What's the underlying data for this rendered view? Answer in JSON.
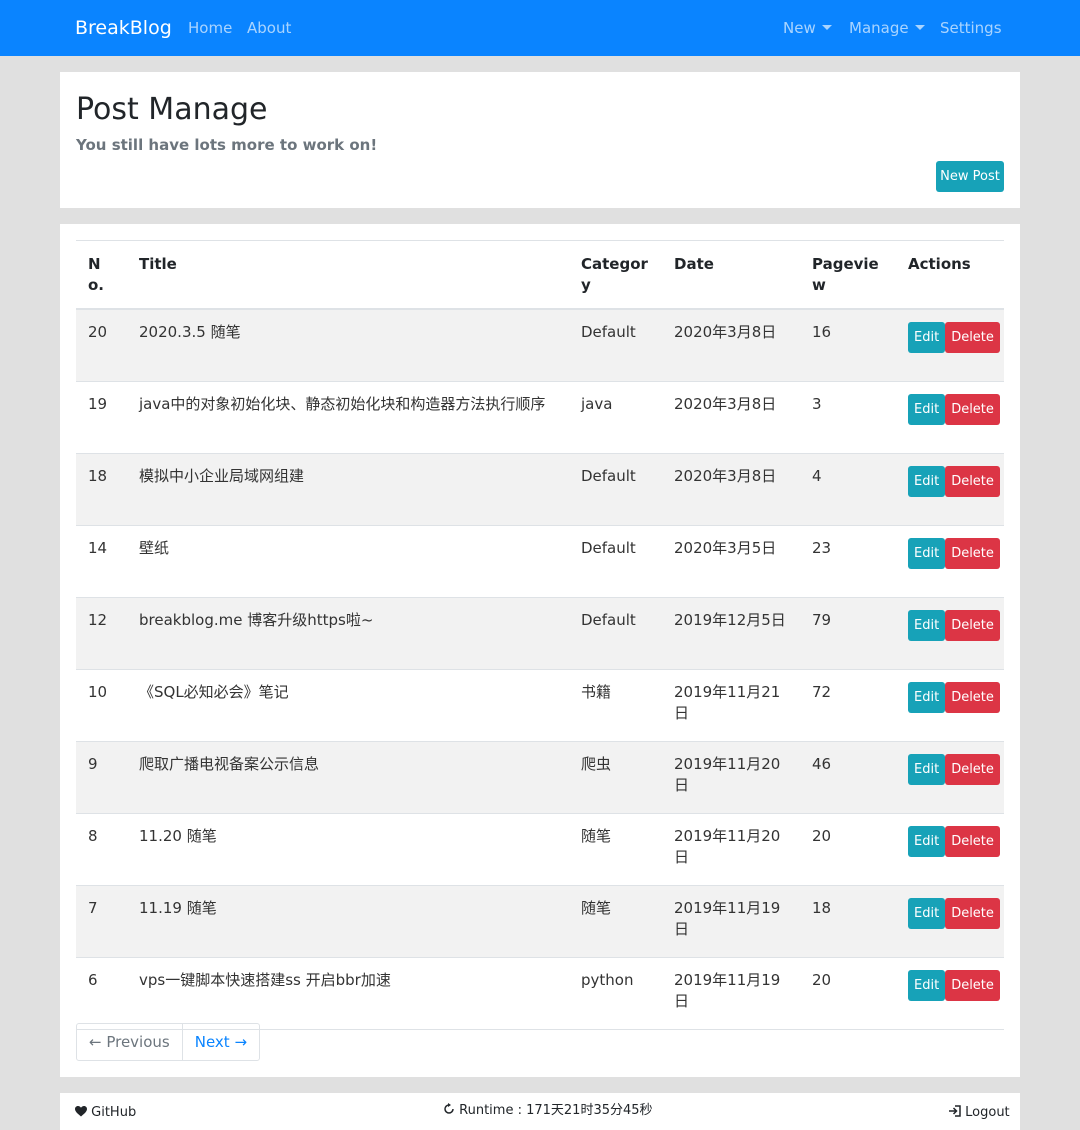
{
  "nav": {
    "brand": "BreakBlog",
    "links": [
      "Home",
      "About"
    ],
    "right": [
      {
        "label": "New",
        "dropdown": true
      },
      {
        "label": "Manage",
        "dropdown": true
      },
      {
        "label": "Settings",
        "dropdown": false
      }
    ]
  },
  "header": {
    "title": "Post Manage",
    "subtitle": "You still have lots more to work on!",
    "new_post_label": "New Post"
  },
  "table": {
    "columns": [
      "No.",
      "Title",
      "Category",
      "Date",
      "Pageview",
      "Actions"
    ],
    "edit_label": "Edit",
    "delete_label": "Delete",
    "rows": [
      {
        "no": "20",
        "title": "2020.3.5 随笔",
        "category": "Default",
        "date": "2020年3月8日",
        "pageview": "16"
      },
      {
        "no": "19",
        "title": "java中的对象初始化块、静态初始化块和构造器方法执行顺序",
        "category": "java",
        "date": "2020年3月8日",
        "pageview": "3"
      },
      {
        "no": "18",
        "title": "模拟中小企业局域网组建",
        "category": "Default",
        "date": "2020年3月8日",
        "pageview": "4"
      },
      {
        "no": "14",
        "title": "壁纸",
        "category": "Default",
        "date": "2020年3月5日",
        "pageview": "23"
      },
      {
        "no": "12",
        "title": "breakblog.me 博客升级https啦~",
        "category": "Default",
        "date": "2019年12月5日",
        "pageview": "79"
      },
      {
        "no": "10",
        "title": "《SQL必知必会》笔记",
        "category": "书籍",
        "date": "2019年11月21日",
        "pageview": "72"
      },
      {
        "no": "9",
        "title": "爬取广播电视备案公示信息",
        "category": "爬虫",
        "date": "2019年11月20日",
        "pageview": "46"
      },
      {
        "no": "8",
        "title": "11.20 随笔",
        "category": "随笔",
        "date": "2019年11月20日",
        "pageview": "20"
      },
      {
        "no": "7",
        "title": "11.19 随笔",
        "category": "随笔",
        "date": "2019年11月19日",
        "pageview": "18"
      },
      {
        "no": "6",
        "title": "vps一键脚本快速搭建ss 开启bbr加速",
        "category": "python",
        "date": "2019年11月19日",
        "pageview": "20"
      }
    ]
  },
  "pager": {
    "prev": "← Previous",
    "next": "Next →"
  },
  "footer": {
    "github": "GitHub",
    "runtime": "Runtime : 171天21时35分45秒",
    "logout": "Logout"
  },
  "colors": {
    "primary": "#0a84ff",
    "info": "#17a2b8",
    "danger": "#dc3545"
  }
}
